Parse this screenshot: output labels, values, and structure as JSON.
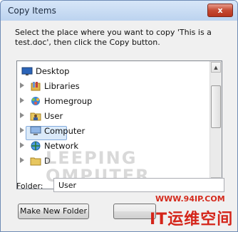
{
  "window": {
    "title": "Copy Items",
    "close_symbol": "x"
  },
  "instructions": "Select the place where you want to copy 'This is a test.doc', then click the Copy button.",
  "tree": {
    "items": [
      {
        "label": "Desktop",
        "icon": "desktop-icon",
        "expandable": false
      },
      {
        "label": "Libraries",
        "icon": "libraries-icon",
        "expandable": true
      },
      {
        "label": "Homegroup",
        "icon": "homegroup-icon",
        "expandable": true
      },
      {
        "label": "User",
        "icon": "user-folder-icon",
        "expandable": true,
        "selected": true
      },
      {
        "label": "Computer",
        "icon": "computer-icon",
        "expandable": true
      },
      {
        "label": "Network",
        "icon": "network-icon",
        "expandable": true
      },
      {
        "label": "D",
        "icon": "folder-icon",
        "expandable": true
      }
    ]
  },
  "folder": {
    "label": "Folder:",
    "value": "User"
  },
  "buttons": {
    "make_new_folder": "Make New Folder"
  },
  "watermark": {
    "line1": "LEEPING",
    "line2": "OMPUTER"
  },
  "site_badge": {
    "url": "WWW.94IP.COM",
    "brand": "IT运维空间"
  },
  "colors": {
    "selection_bg": "#dbeaf9",
    "close_button": "#c54a33",
    "brand_red": "#d4251a"
  }
}
